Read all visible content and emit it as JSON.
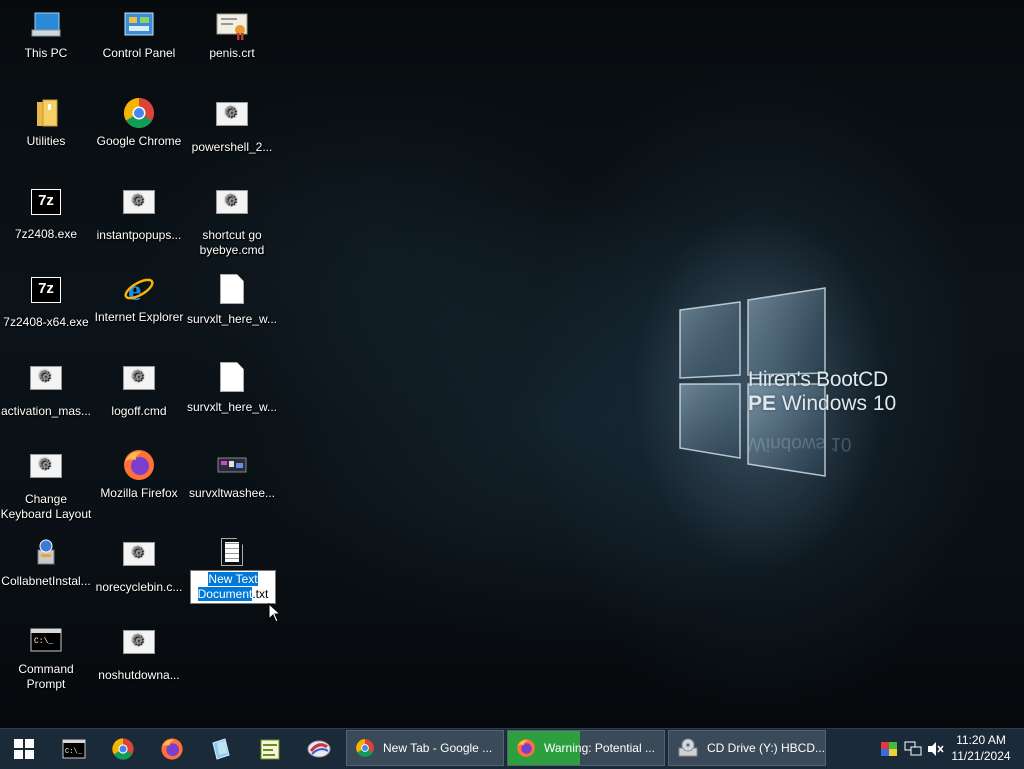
{
  "wallpaper": {
    "brand_line1": "Hiren's BootCD",
    "brand_line2_bold": "PE",
    "brand_line2_rest": " Windows 10",
    "brand_reflection": "Windows 10"
  },
  "desktop_icons": [
    {
      "label": "This PC",
      "icon": "this-pc-icon"
    },
    {
      "label": "Control Panel",
      "icon": "control-panel-icon"
    },
    {
      "label": "penis.crt",
      "icon": "certificate-icon"
    },
    {
      "label": "Utilities",
      "icon": "folder-icon"
    },
    {
      "label": "Google Chrome",
      "icon": "chrome-icon"
    },
    {
      "label": "powershell_2...",
      "icon": "script-file-icon"
    },
    {
      "label": "7z2408.exe",
      "icon": "7zip-icon"
    },
    {
      "label": "instantpopups...",
      "icon": "script-file-icon"
    },
    {
      "label": "shortcut go byebye.cmd",
      "icon": "script-file-icon"
    },
    {
      "label": "7z2408-x64.exe",
      "icon": "7zip-icon"
    },
    {
      "label": "Internet Explorer",
      "icon": "internet-explorer-icon"
    },
    {
      "label": "survxlt_here_w...",
      "icon": "blank-file-icon"
    },
    {
      "label": "activation_mas...",
      "icon": "script-file-icon"
    },
    {
      "label": "logoff.cmd",
      "icon": "script-file-icon"
    },
    {
      "label": "survxlt_here_w...",
      "icon": "blank-file-icon"
    },
    {
      "label": "Change Keyboard Layout",
      "icon": "script-file-icon"
    },
    {
      "label": "Mozilla Firefox",
      "icon": "firefox-icon"
    },
    {
      "label": "survxltwashee...",
      "icon": "image-file-icon"
    },
    {
      "label": "CollabnetInstal...",
      "icon": "installer-icon"
    },
    {
      "label": "norecyclebin.c...",
      "icon": "script-file-icon"
    },
    {
      "label": "Command Prompt",
      "icon": "command-prompt-icon"
    },
    {
      "label": "noshutdowna...",
      "icon": "script-file-icon"
    }
  ],
  "rename_icon": {
    "selected_text": "New Text Document",
    "extension": ".txt",
    "icon": "text-document-icon"
  },
  "taskbar": {
    "pinned": [
      {
        "name": "start-button",
        "icon": "windows-logo-icon"
      },
      {
        "name": "pinned-command-prompt",
        "icon": "command-prompt-icon"
      },
      {
        "name": "pinned-chrome",
        "icon": "chrome-icon"
      },
      {
        "name": "pinned-firefox",
        "icon": "firefox-icon"
      },
      {
        "name": "pinned-explorer",
        "icon": "explorer-icon"
      },
      {
        "name": "pinned-notepad",
        "icon": "notepad-icon"
      },
      {
        "name": "pinned-tool",
        "icon": "tool-icon"
      }
    ],
    "tasks": [
      {
        "label": "New Tab - Google ...",
        "icon": "chrome-icon"
      },
      {
        "label": "Warning: Potential ...",
        "icon": "firefox-icon"
      },
      {
        "label": "CD Drive (Y:) HBCD...",
        "icon": "cd-drive-icon"
      }
    ],
    "tray_icons": [
      "color-icon",
      "network-icon",
      "volume-muted-icon"
    ],
    "clock": {
      "time": "11:20 AM",
      "date": "11/21/2024"
    }
  }
}
